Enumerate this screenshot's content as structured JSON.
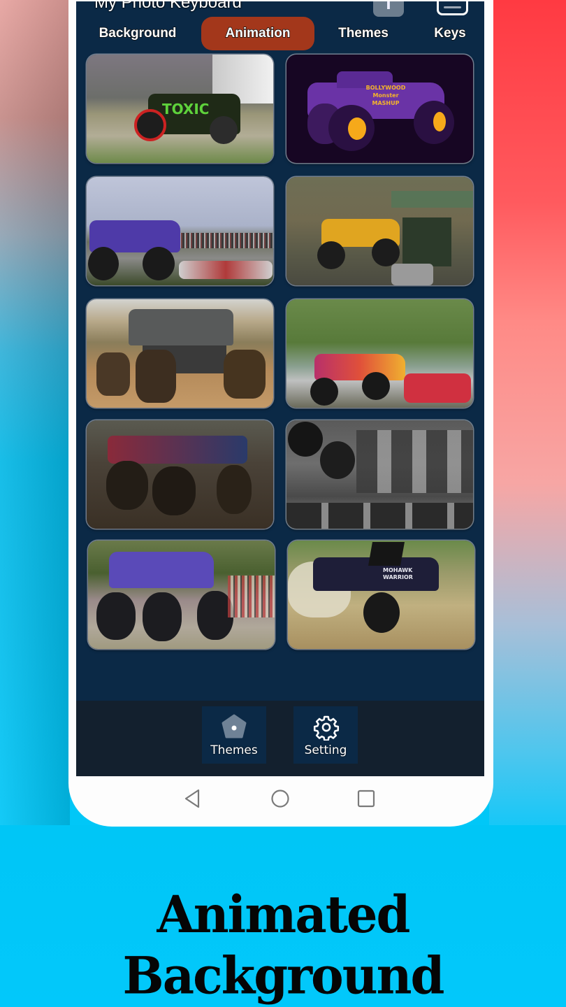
{
  "app": {
    "title": "My Photo Keyboard",
    "font_button_label": "T",
    "font_button_icon": "font-size-icon",
    "keyboard_button_icon": "keyboard-icon"
  },
  "tabs": [
    {
      "label": "Background",
      "active": false
    },
    {
      "label": "Animation",
      "active": true
    },
    {
      "label": "Themes",
      "active": false
    },
    {
      "label": "Keys",
      "active": false
    }
  ],
  "animations": [
    {
      "name": "toxic-green-monster-truck",
      "text": "TOXIC"
    },
    {
      "name": "bollywood-monster-mashup",
      "text": "BOLLYWOOD Monster MASHUP"
    },
    {
      "name": "purple-truck-at-stadium",
      "text": ""
    },
    {
      "name": "yellow-truck-on-dirt-track",
      "text": ""
    },
    {
      "name": "grey-truck-on-field",
      "text": ""
    },
    {
      "name": "pink-truck-crushing-cars",
      "text": ""
    },
    {
      "name": "blue-truck-in-mud",
      "text": ""
    },
    {
      "name": "black-and-white-truck-jump",
      "text": ""
    },
    {
      "name": "purple-truck-at-fair",
      "text": ""
    },
    {
      "name": "mohawk-warrior-truck",
      "text": "MOHAWK WARRIOR"
    }
  ],
  "bottom_nav": [
    {
      "label": "Themes",
      "icon": "pentagon-icon"
    },
    {
      "label": "Setting",
      "icon": "gear-icon"
    }
  ],
  "system_nav": {
    "back_icon": "back-triangle-icon",
    "home_icon": "home-circle-icon",
    "recents_icon": "recents-square-icon"
  },
  "caption": "Animated Background",
  "colors": {
    "screen_bg": "#0b2946",
    "active_tab": "#a3371b",
    "nav_bg": "#13202e",
    "caption": "#050505"
  }
}
